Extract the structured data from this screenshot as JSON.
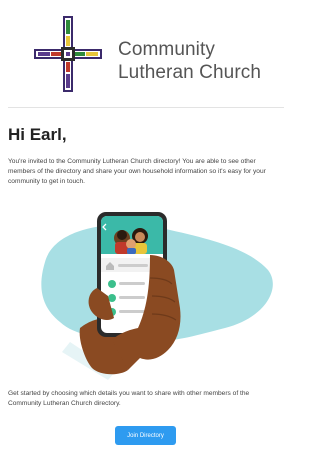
{
  "header": {
    "church_name_line1": "Community",
    "church_name_line2": "Lutheran Church"
  },
  "greeting": "Hi Earl,",
  "intro_text": "You're invited to the Community Lutheran Church directory! You are able to see other members of the directory and share your own household information so it's easy for your community to get in touch.",
  "footer_text": "Get started by choosing which details you want to share with other members of the Community Lutheran Church directory.",
  "join_button_label": "Join Directory",
  "colors": {
    "accent": "#2e9bf0",
    "blob": "#a8dfe4",
    "phone": "#2b2b2b",
    "hand": "#8a4a22",
    "green_icon": "#3bbf8c",
    "cross_green": "#2f8a3c",
    "cross_purple": "#5a3b8c",
    "cross_red": "#c0392b",
    "cross_yellow": "#e7c53a"
  },
  "icons": [
    "cross-logo-icon",
    "back-arrow-icon",
    "home-icon",
    "person-icon"
  ]
}
